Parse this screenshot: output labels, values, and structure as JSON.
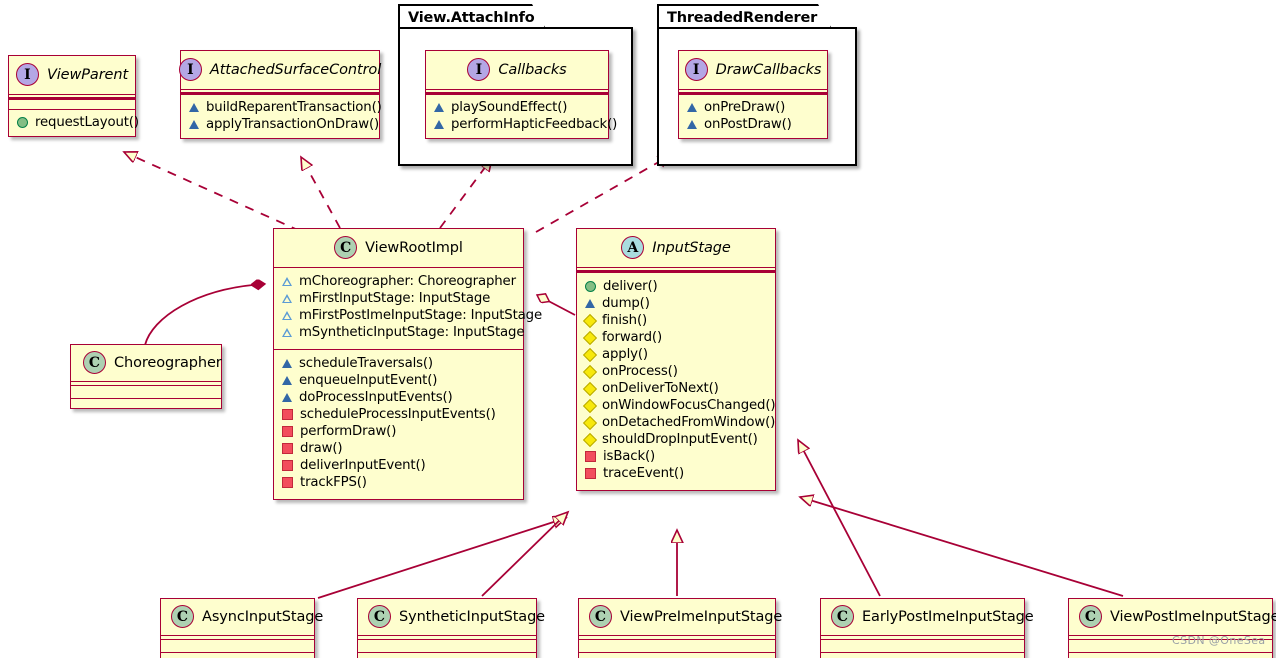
{
  "diagram": {
    "kind": "uml-class-diagram",
    "colors": {
      "class_fill": "#FEFECE",
      "class_border": "#A80036",
      "package_border": "#000000",
      "package_fill": "#FFFFFF",
      "line": "#A80036",
      "class_icon": "#ADD1B2",
      "interface_icon": "#B4A7E5",
      "abstract_icon": "#A9DCDF",
      "public_marker": "#84BE84",
      "protected_marker": "#3267A6",
      "package_marker": "#F7E80A",
      "private_marker": "#F24D5C"
    },
    "watermark": "CSDN @OneSea"
  },
  "packages": [
    {
      "name": "View.AttachInfo"
    },
    {
      "name": "ThreadedRenderer"
    }
  ],
  "classifiers": [
    {
      "id": "viewparent",
      "stereotype": "I",
      "stereotype_label": "interface",
      "name": "ViewParent",
      "italic": true,
      "attributes": [],
      "methods": [
        {
          "visibility": "public",
          "marker": "pub",
          "label": "requestLayout()"
        }
      ]
    },
    {
      "id": "attachedsurfacecontrol",
      "stereotype": "I",
      "stereotype_label": "interface",
      "name": "AttachedSurfaceControl",
      "italic": true,
      "attributes": [],
      "methods": [
        {
          "visibility": "protected",
          "marker": "prot",
          "label": "buildReparentTransaction()"
        },
        {
          "visibility": "protected",
          "marker": "prot",
          "label": "applyTransactionOnDraw()"
        }
      ]
    },
    {
      "id": "callbacks",
      "stereotype": "I",
      "stereotype_label": "interface",
      "name": "Callbacks",
      "italic": true,
      "attributes": [],
      "methods": [
        {
          "visibility": "protected",
          "marker": "prot",
          "label": "playSoundEffect()"
        },
        {
          "visibility": "protected",
          "marker": "prot",
          "label": "performHapticFeedback()"
        }
      ]
    },
    {
      "id": "drawcallbacks",
      "stereotype": "I",
      "stereotype_label": "interface",
      "name": "DrawCallbacks",
      "italic": true,
      "attributes": [],
      "methods": [
        {
          "visibility": "protected",
          "marker": "prot",
          "label": "onPreDraw()"
        },
        {
          "visibility": "protected",
          "marker": "prot",
          "label": "onPostDraw()"
        }
      ]
    },
    {
      "id": "viewrootimpl",
      "stereotype": "C",
      "stereotype_label": "class",
      "name": "ViewRootImpl",
      "italic": false,
      "attributes": [
        {
          "visibility": "protected",
          "marker": "protf",
          "label": "mChoreographer: Choreographer"
        },
        {
          "visibility": "protected",
          "marker": "protf",
          "label": "mFirstInputStage: InputStage"
        },
        {
          "visibility": "protected",
          "marker": "protf",
          "label": "mFirstPostImeInputStage: InputStage"
        },
        {
          "visibility": "protected",
          "marker": "protf",
          "label": "mSyntheticInputStage: InputStage"
        }
      ],
      "methods": [
        {
          "visibility": "protected",
          "marker": "prot",
          "label": "scheduleTraversals()"
        },
        {
          "visibility": "protected",
          "marker": "prot",
          "label": "enqueueInputEvent()"
        },
        {
          "visibility": "protected",
          "marker": "prot",
          "label": "doProcessInputEvents()"
        },
        {
          "visibility": "private",
          "marker": "priv",
          "label": "scheduleProcessInputEvents()"
        },
        {
          "visibility": "private",
          "marker": "priv",
          "label": "performDraw()"
        },
        {
          "visibility": "private",
          "marker": "priv",
          "label": "draw()"
        },
        {
          "visibility": "private",
          "marker": "priv",
          "label": "deliverInputEvent()"
        },
        {
          "visibility": "private",
          "marker": "priv",
          "label": "trackFPS()"
        }
      ]
    },
    {
      "id": "inputstage",
      "stereotype": "A",
      "stereotype_label": "abstract class",
      "name": "InputStage",
      "italic": true,
      "attributes": [],
      "methods": [
        {
          "visibility": "public",
          "marker": "pub",
          "label": "deliver()"
        },
        {
          "visibility": "protected",
          "marker": "prot",
          "label": "dump()"
        },
        {
          "visibility": "package",
          "marker": "pkgp",
          "label": "finish()"
        },
        {
          "visibility": "package",
          "marker": "pkgp",
          "label": "forward()"
        },
        {
          "visibility": "package",
          "marker": "pkgp",
          "label": "apply()"
        },
        {
          "visibility": "package",
          "marker": "pkgp",
          "label": "onProcess()"
        },
        {
          "visibility": "package",
          "marker": "pkgp",
          "label": "onDeliverToNext()"
        },
        {
          "visibility": "package",
          "marker": "pkgp",
          "label": "onWindowFocusChanged()"
        },
        {
          "visibility": "package",
          "marker": "pkgp",
          "label": "onDetachedFromWindow()"
        },
        {
          "visibility": "package",
          "marker": "pkgp",
          "label": "shouldDropInputEvent()"
        },
        {
          "visibility": "private",
          "marker": "priv",
          "label": "isBack()"
        },
        {
          "visibility": "private",
          "marker": "priv",
          "label": "traceEvent()"
        }
      ]
    },
    {
      "id": "choreographer",
      "stereotype": "C",
      "stereotype_label": "class",
      "name": "Choreographer",
      "italic": false,
      "attributes": [],
      "methods": []
    },
    {
      "id": "asyncinputstage",
      "stereotype": "C",
      "stereotype_label": "class",
      "name": "AsyncInputStage",
      "italic": false,
      "attributes": [],
      "methods": []
    },
    {
      "id": "syntheticinputstage",
      "stereotype": "C",
      "stereotype_label": "class",
      "name": "SyntheticInputStage",
      "italic": false,
      "attributes": [],
      "methods": []
    },
    {
      "id": "viewpreimeinputstage",
      "stereotype": "C",
      "stereotype_label": "class",
      "name": "ViewPreImeInputStage",
      "italic": false,
      "attributes": [],
      "methods": []
    },
    {
      "id": "earlypostimeinputstage",
      "stereotype": "C",
      "stereotype_label": "class",
      "name": "EarlyPostImeInputStage",
      "italic": false,
      "attributes": [],
      "methods": []
    },
    {
      "id": "viewpostimeinputstage",
      "stereotype": "C",
      "stereotype_label": "class",
      "name": "ViewPostImeInputStage",
      "italic": false,
      "attributes": [],
      "methods": []
    }
  ],
  "relationships": [
    {
      "from": "viewrootimpl",
      "to": "viewparent",
      "type": "realization"
    },
    {
      "from": "viewrootimpl",
      "to": "attachedsurfacecontrol",
      "type": "realization"
    },
    {
      "from": "viewrootimpl",
      "to": "callbacks",
      "type": "realization"
    },
    {
      "from": "viewrootimpl",
      "to": "drawcallbacks",
      "type": "realization"
    },
    {
      "from": "choreographer",
      "to": "viewrootimpl",
      "type": "composition"
    },
    {
      "from": "inputstage",
      "to": "viewrootimpl",
      "type": "aggregation"
    },
    {
      "from": "asyncinputstage",
      "to": "inputstage",
      "type": "inheritance"
    },
    {
      "from": "syntheticinputstage",
      "to": "inputstage",
      "type": "inheritance"
    },
    {
      "from": "viewpreimeinputstage",
      "to": "inputstage",
      "type": "inheritance"
    },
    {
      "from": "earlypostimeinputstage",
      "to": "inputstage",
      "type": "inheritance"
    },
    {
      "from": "viewpostimeinputstage",
      "to": "inputstage",
      "type": "inheritance"
    }
  ]
}
